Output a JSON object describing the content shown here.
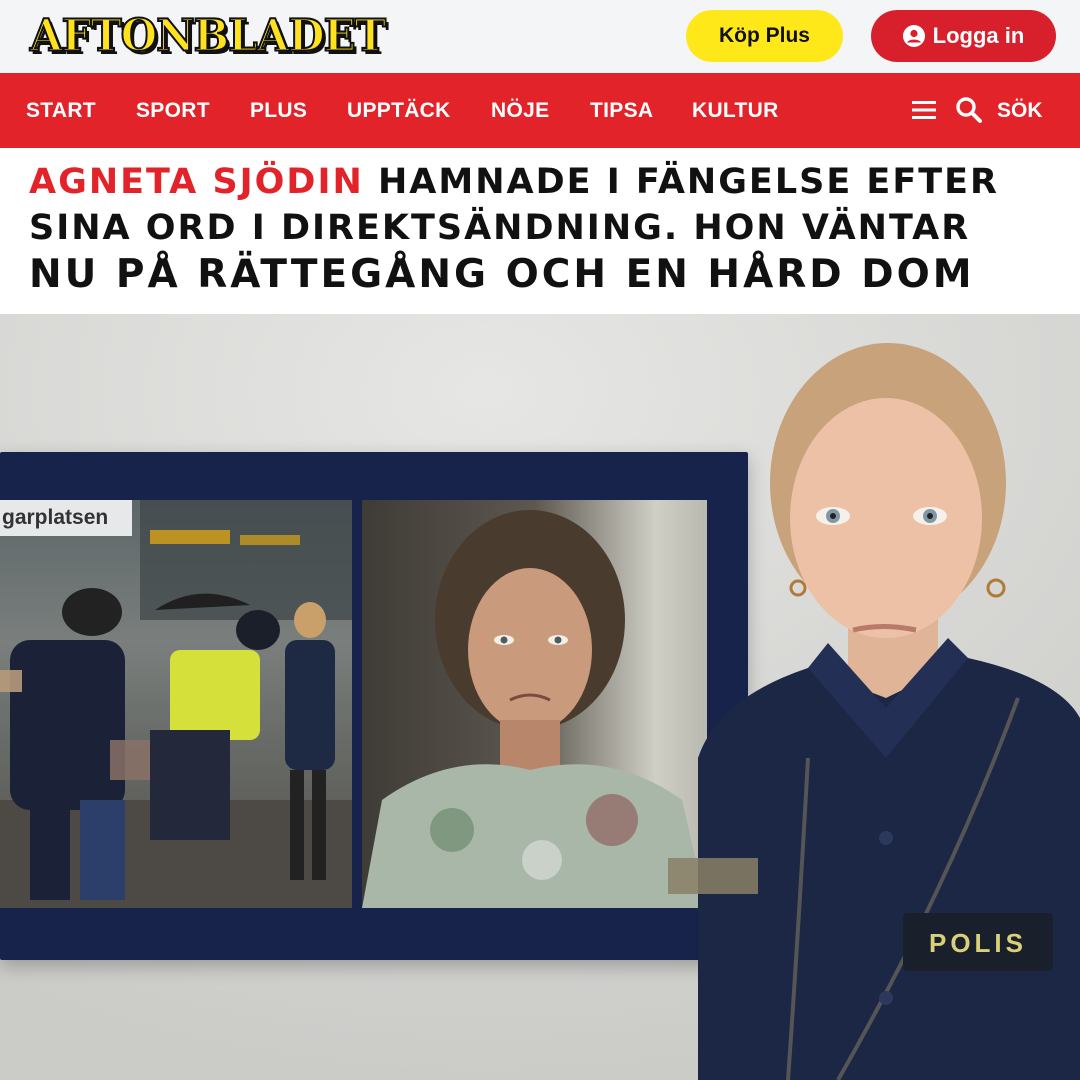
{
  "header": {
    "logo_text": "AFTONBLADET",
    "buy_plus_label": "Köp Plus",
    "login_label": "Logga in"
  },
  "nav": {
    "items": [
      "START",
      "SPORT",
      "PLUS",
      "UPPTÄCK",
      "NÖJE",
      "TIPSA",
      "KULTUR"
    ],
    "search_label": "SÖK"
  },
  "headline": {
    "highlight": "AGNETA SJÖDIN",
    "line1_rest": " HAMNADE I FÄNGELSE EFTER",
    "line2": "SINA ORD I DIREKTSÄNDNING. HON VÄNTAR",
    "line3": "NU PÅ RÄTTEGÅNG OCH EN HÅRD DOM"
  },
  "image": {
    "screen_sign_text": "garplatsen",
    "badge_text": "POLIS"
  },
  "colors": {
    "brand_red": "#e2232a",
    "brand_yellow": "#ffe81a",
    "uniform_navy": "#1c2746"
  },
  "icons": {
    "menu": "menu-icon",
    "search": "search-icon",
    "user": "user-icon"
  }
}
